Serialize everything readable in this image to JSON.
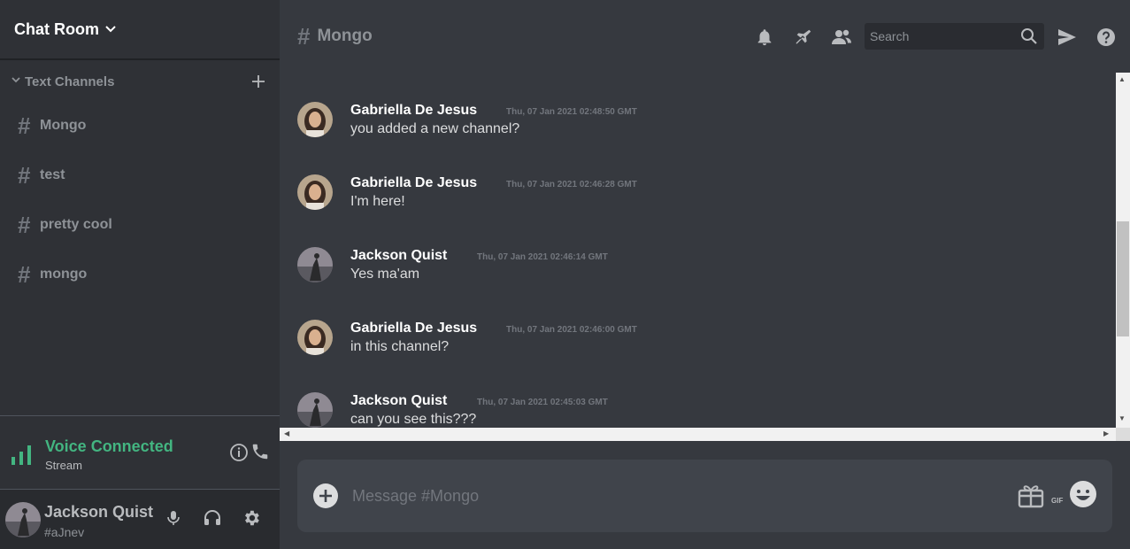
{
  "server": {
    "name": "Chat Room"
  },
  "sidebar": {
    "category_label": "Text Channels",
    "channels": [
      {
        "hash": "#",
        "name": "Mongo"
      },
      {
        "hash": "#",
        "name": "test"
      },
      {
        "hash": "#",
        "name": "pretty cool"
      },
      {
        "hash": "#",
        "name": "mongo"
      }
    ]
  },
  "voice": {
    "status": "Voice Connected",
    "subtitle": "Stream",
    "accent_color": "#43b581"
  },
  "user": {
    "name": "Jackson Quist",
    "tag": "#aJnev"
  },
  "header": {
    "hash": "#",
    "channel_title": "Mongo",
    "search_placeholder": "Search",
    "icons": [
      "bell-icon",
      "pin-icon",
      "members-icon",
      "search-icon",
      "send-icon",
      "help-icon"
    ]
  },
  "messages": [
    {
      "author": "Gabriella De Jesus",
      "timestamp": "Thu, 07 Jan 2021 02:48:50 GMT",
      "text": "you added a new channel?"
    },
    {
      "author": "Gabriella De Jesus",
      "timestamp": "Thu, 07 Jan 2021 02:46:28 GMT",
      "text": "I'm here!"
    },
    {
      "author": "Jackson Quist",
      "timestamp": "Thu, 07 Jan 2021 02:46:14 GMT",
      "text": "Yes ma'am"
    },
    {
      "author": "Gabriella De Jesus",
      "timestamp": "Thu, 07 Jan 2021 02:46:00 GMT",
      "text": "in this channel?"
    },
    {
      "author": "Jackson Quist",
      "timestamp": "Thu, 07 Jan 2021 02:45:03 GMT",
      "text": "can you see this???"
    }
  ],
  "composer": {
    "placeholder": "Message #Mongo",
    "gif_label": "GIF"
  }
}
